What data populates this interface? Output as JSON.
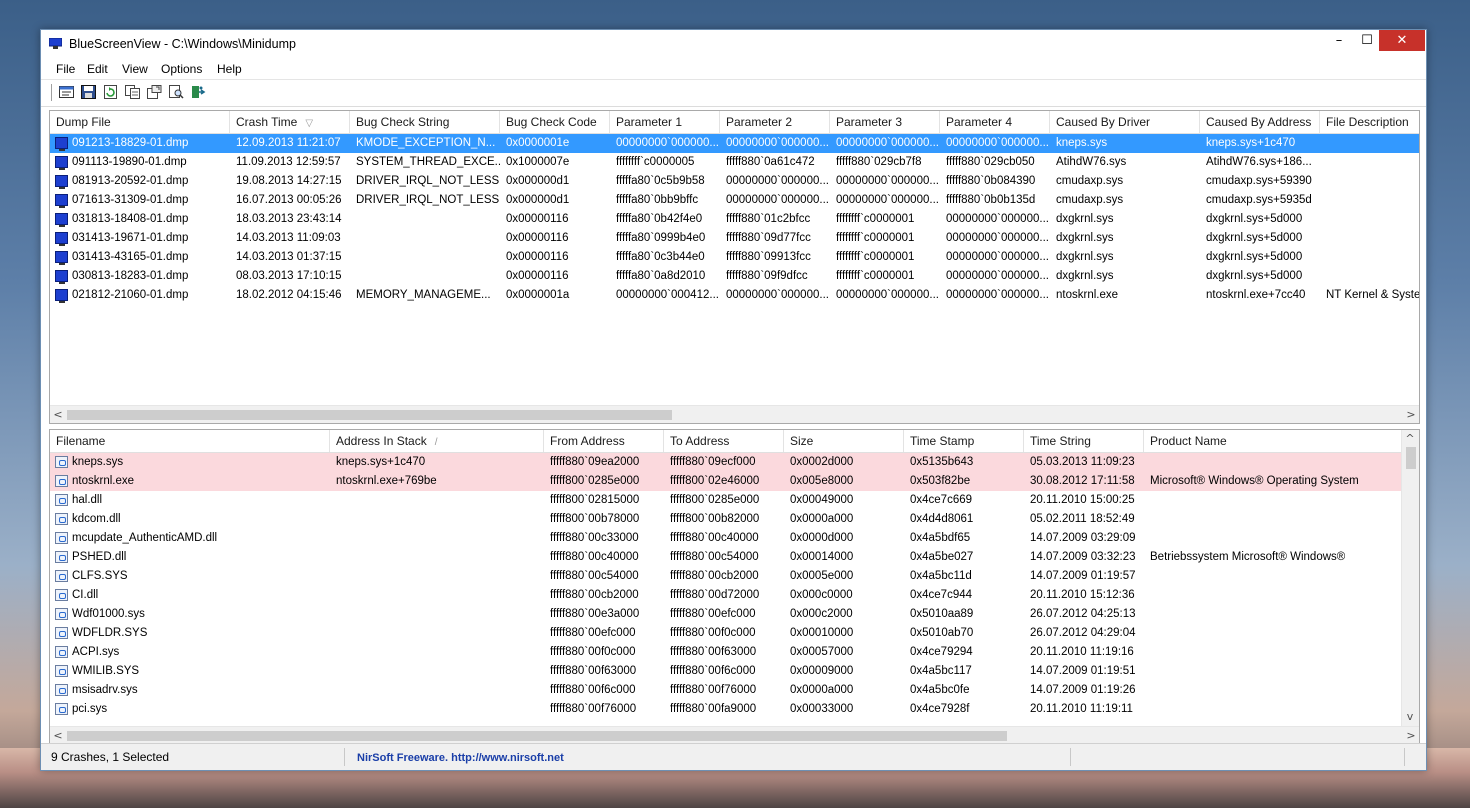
{
  "window": {
    "title": "BlueScreenView  -  C:\\Windows\\Minidump",
    "min_glyph": "–",
    "max_glyph": "☐",
    "close_glyph": "✕"
  },
  "menu": [
    "File",
    "Edit",
    "View",
    "Options",
    "Help"
  ],
  "toolbar_icons": [
    "properties-icon",
    "save-icon",
    "refresh-icon",
    "copy-icon",
    "html-report-icon",
    "find-icon",
    "exit-icon"
  ],
  "crash_list": {
    "columns": [
      "Dump File",
      "Crash Time",
      "Bug Check String",
      "Bug Check Code",
      "Parameter 1",
      "Parameter 2",
      "Parameter 3",
      "Parameter 4",
      "Caused By Driver",
      "Caused By Address",
      "File Description"
    ],
    "sort_glyph": "▽",
    "rows": [
      [
        "091213-18829-01.dmp",
        "12.09.2013 11:21:07",
        "KMODE_EXCEPTION_N...",
        "0x0000001e",
        "00000000`000000...",
        "00000000`000000...",
        "00000000`000000...",
        "00000000`000000...",
        "kneps.sys",
        "kneps.sys+1c470",
        ""
      ],
      [
        "091113-19890-01.dmp",
        "11.09.2013 12:59:57",
        "SYSTEM_THREAD_EXCE...",
        "0x1000007e",
        "ffffffff`c0000005",
        "fffff880`0a61c472",
        "fffff880`029cb7f8",
        "fffff880`029cb050",
        "AtihdW76.sys",
        "AtihdW76.sys+186...",
        ""
      ],
      [
        "081913-20592-01.dmp",
        "19.08.2013 14:27:15",
        "DRIVER_IRQL_NOT_LESS...",
        "0x000000d1",
        "fffffa80`0c5b9b58",
        "00000000`000000...",
        "00000000`000000...",
        "fffff880`0b084390",
        "cmudaxp.sys",
        "cmudaxp.sys+59390",
        ""
      ],
      [
        "071613-31309-01.dmp",
        "16.07.2013 00:05:26",
        "DRIVER_IRQL_NOT_LESS...",
        "0x000000d1",
        "fffffa80`0bb9bffc",
        "00000000`000000...",
        "00000000`000000...",
        "fffff880`0b0b135d",
        "cmudaxp.sys",
        "cmudaxp.sys+5935d",
        ""
      ],
      [
        "031813-18408-01.dmp",
        "18.03.2013 23:43:14",
        "",
        "0x00000116",
        "fffffa80`0b42f4e0",
        "fffff880`01c2bfcc",
        "ffffffff`c0000001",
        "00000000`000000...",
        "dxgkrnl.sys",
        "dxgkrnl.sys+5d000",
        ""
      ],
      [
        "031413-19671-01.dmp",
        "14.03.2013 11:09:03",
        "",
        "0x00000116",
        "fffffa80`0999b4e0",
        "fffff880`09d77fcc",
        "ffffffff`c0000001",
        "00000000`000000...",
        "dxgkrnl.sys",
        "dxgkrnl.sys+5d000",
        ""
      ],
      [
        "031413-43165-01.dmp",
        "14.03.2013 01:37:15",
        "",
        "0x00000116",
        "fffffa80`0c3b44e0",
        "fffff880`09913fcc",
        "ffffffff`c0000001",
        "00000000`000000...",
        "dxgkrnl.sys",
        "dxgkrnl.sys+5d000",
        ""
      ],
      [
        "030813-18283-01.dmp",
        "08.03.2013 17:10:15",
        "",
        "0x00000116",
        "fffffa80`0a8d2010",
        "fffff880`09f9dfcc",
        "ffffffff`c0000001",
        "00000000`000000...",
        "dxgkrnl.sys",
        "dxgkrnl.sys+5d000",
        ""
      ],
      [
        "021812-21060-01.dmp",
        "18.02.2012 04:15:46",
        "MEMORY_MANAGEME...",
        "0x0000001a",
        "00000000`000412...",
        "00000000`000000...",
        "00000000`000000...",
        "00000000`000000...",
        "ntoskrnl.exe",
        "ntoskrnl.exe+7cc40",
        "NT Kernel & System"
      ]
    ]
  },
  "driver_list": {
    "columns": [
      "Filename",
      "Address In Stack",
      "From Address",
      "To Address",
      "Size",
      "Time Stamp",
      "Time String",
      "Product Name"
    ],
    "sort_glyph": "/",
    "rows": [
      [
        "kneps.sys",
        "kneps.sys+1c470",
        "fffff880`09ea2000",
        "fffff880`09ecf000",
        "0x0002d000",
        "0x5135b643",
        "05.03.2013 11:09:23",
        ""
      ],
      [
        "ntoskrnl.exe",
        "ntoskrnl.exe+769be",
        "fffff800`0285e000",
        "fffff800`02e46000",
        "0x005e8000",
        "0x503f82be",
        "30.08.2012 17:11:58",
        "Microsoft® Windows® Operating System"
      ],
      [
        "hal.dll",
        "",
        "fffff800`02815000",
        "fffff800`0285e000",
        "0x00049000",
        "0x4ce7c669",
        "20.11.2010 15:00:25",
        ""
      ],
      [
        "kdcom.dll",
        "",
        "fffff800`00b78000",
        "fffff800`00b82000",
        "0x0000a000",
        "0x4d4d8061",
        "05.02.2011 18:52:49",
        ""
      ],
      [
        "mcupdate_AuthenticAMD.dll",
        "",
        "fffff880`00c33000",
        "fffff880`00c40000",
        "0x0000d000",
        "0x4a5bdf65",
        "14.07.2009 03:29:09",
        ""
      ],
      [
        "PSHED.dll",
        "",
        "fffff880`00c40000",
        "fffff880`00c54000",
        "0x00014000",
        "0x4a5be027",
        "14.07.2009 03:32:23",
        "Betriebssystem Microsoft® Windows®"
      ],
      [
        "CLFS.SYS",
        "",
        "fffff880`00c54000",
        "fffff880`00cb2000",
        "0x0005e000",
        "0x4a5bc11d",
        "14.07.2009 01:19:57",
        ""
      ],
      [
        "CI.dll",
        "",
        "fffff880`00cb2000",
        "fffff880`00d72000",
        "0x000c0000",
        "0x4ce7c944",
        "20.11.2010 15:12:36",
        ""
      ],
      [
        "Wdf01000.sys",
        "",
        "fffff880`00e3a000",
        "fffff880`00efc000",
        "0x000c2000",
        "0x5010aa89",
        "26.07.2012 04:25:13",
        ""
      ],
      [
        "WDFLDR.SYS",
        "",
        "fffff880`00efc000",
        "fffff880`00f0c000",
        "0x00010000",
        "0x5010ab70",
        "26.07.2012 04:29:04",
        ""
      ],
      [
        "ACPI.sys",
        "",
        "fffff880`00f0c000",
        "fffff880`00f63000",
        "0x00057000",
        "0x4ce79294",
        "20.11.2010 11:19:16",
        ""
      ],
      [
        "WMILIB.SYS",
        "",
        "fffff880`00f63000",
        "fffff880`00f6c000",
        "0x00009000",
        "0x4a5bc117",
        "14.07.2009 01:19:51",
        ""
      ],
      [
        "msisadrv.sys",
        "",
        "fffff880`00f6c000",
        "fffff880`00f76000",
        "0x0000a000",
        "0x4a5bc0fe",
        "14.07.2009 01:19:26",
        ""
      ],
      [
        "pci.sys",
        "",
        "fffff880`00f76000",
        "fffff880`00fa9000",
        "0x00033000",
        "0x4ce7928f",
        "20.11.2010 11:19:11",
        ""
      ]
    ]
  },
  "status": {
    "count_text": "9 Crashes, 1 Selected",
    "credit_text": "NirSoft Freeware.  http://www.nirsoft.net"
  },
  "colors": {
    "selected_row": "#3399ff",
    "highlight_row": "#fbd9dd",
    "close_button": "#c7312a",
    "link": "#1a3ea8"
  }
}
